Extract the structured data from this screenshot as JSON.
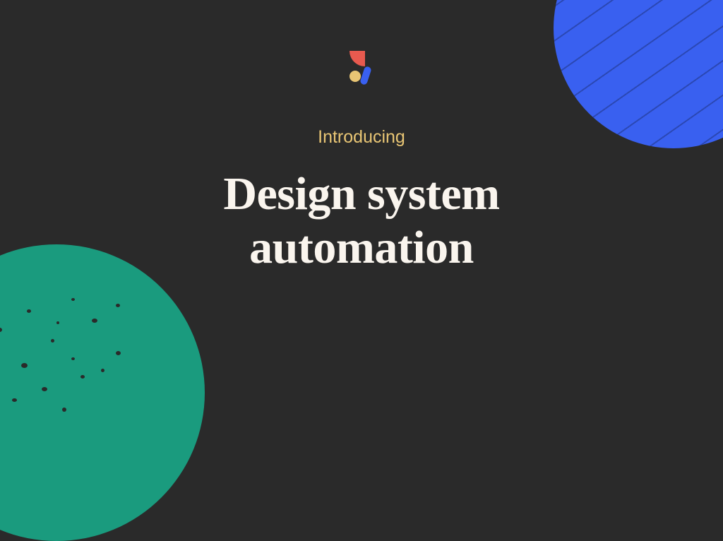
{
  "subtitle": "Introducing",
  "title_line1": "Design system",
  "title_line2": "automation",
  "colors": {
    "background": "#2a2a2a",
    "accent_yellow": "#e8c574",
    "text": "#faf5ee",
    "blue": "#3960f0",
    "green": "#1a9b7e",
    "logo_red": "#e85a4f",
    "logo_yellow": "#e8c574",
    "logo_blue": "#3960f0"
  }
}
